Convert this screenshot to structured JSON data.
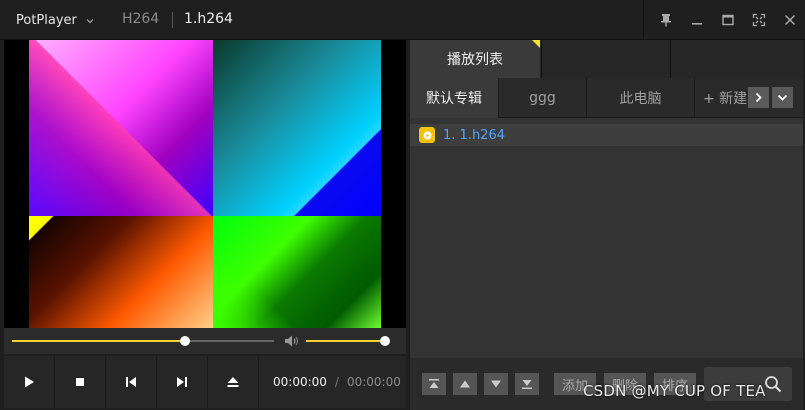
{
  "titlebar": {
    "app_name": "PotPlayer",
    "codec": "H264",
    "filename": "1.h264"
  },
  "playback": {
    "current_time": "00:00:00",
    "separator": "/",
    "total_time": "00:00:00",
    "seek_fraction": 0.66,
    "volume_fraction": 0.96
  },
  "playlist": {
    "tab_label": "播放列表",
    "albums": [
      "默认专辑",
      "ggg",
      "此电脑",
      "+ 新建"
    ],
    "items": [
      {
        "label": "1. 1.h264"
      }
    ],
    "bottom": {
      "add_label": "添加",
      "delete_label": "删除",
      "sort_label": "排序"
    }
  },
  "watermark": "CSDN @MY CUP OF TEA",
  "colors": {
    "accent": "#f4cf2f",
    "playlist_item_text": "#4ea6ff",
    "item_icon": "#f4c20d"
  },
  "icons": {
    "window": [
      "pin-icon",
      "minimize-icon",
      "maximize-icon",
      "fullscreen-icon",
      "close-icon"
    ],
    "controls": [
      "play-icon",
      "stop-icon",
      "previous-icon",
      "next-icon",
      "eject-icon"
    ],
    "playlist_move": [
      "move-top-icon",
      "move-up-icon",
      "move-down-icon",
      "move-bottom-icon"
    ]
  }
}
